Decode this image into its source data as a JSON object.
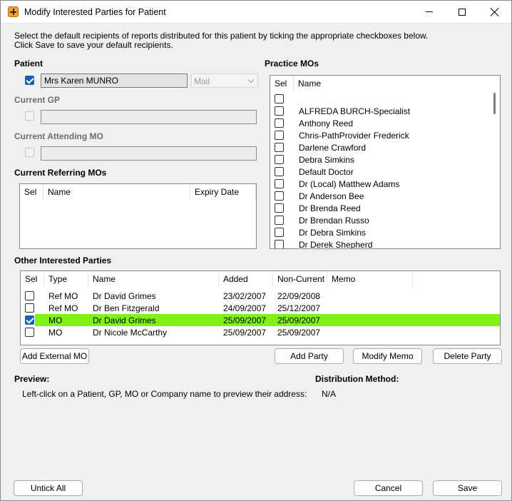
{
  "window": {
    "title": "Modify Interested Parties for Patient"
  },
  "instructions": {
    "line1": "Select the default recipients of reports distributed for this patient by ticking the appropriate checkboxes below.",
    "line2": "Click Save to save your default recipients."
  },
  "patient": {
    "label": "Patient",
    "name": "Mrs Karen MUNRO",
    "checked": true,
    "method_value": "Mail"
  },
  "current_gp": {
    "label": "Current GP",
    "value": ""
  },
  "current_attending_mo": {
    "label": "Current Attending MO",
    "value": ""
  },
  "current_referring_mos": {
    "label": "Current Referring MOs",
    "columns": [
      "Sel",
      "Name",
      "Expiry Date"
    ],
    "rows": []
  },
  "practice_mos": {
    "label": "Practice MOs",
    "columns": [
      "Sel",
      "Name"
    ],
    "rows": [
      "",
      "ALFREDA BURCH-Specialist",
      "Anthony Reed",
      "Chris-PathProvider Frederick",
      "Darlene Crawford",
      "Debra Simkins",
      "Default Doctor",
      "Dr (Local) Matthew Adams",
      "Dr Anderson Bee",
      "Dr Brenda Reed",
      "Dr Brendan Russo",
      "Dr Debra Simkins",
      "Dr Derek Shepherd"
    ]
  },
  "other_parties": {
    "label": "Other Interested Parties",
    "columns": [
      "Sel",
      "Type",
      "Name",
      "Added",
      "Non-Current",
      "Memo"
    ],
    "rows": [
      {
        "checked": false,
        "type": "Ref MO",
        "name": "Dr David Grimes",
        "added": "23/02/2007",
        "noncurrent": "22/09/2008",
        "memo": ""
      },
      {
        "checked": false,
        "type": "Ref MO",
        "name": "Dr Ben Fitzgerald",
        "added": "24/09/2007",
        "noncurrent": "25/12/2007",
        "memo": ""
      },
      {
        "checked": true,
        "type": "MO",
        "name": "Dr David Grimes",
        "added": "25/09/2007",
        "noncurrent": "25/09/2007",
        "memo": "",
        "selected": true
      },
      {
        "checked": false,
        "type": "MO",
        "name": "Dr Nicole McCarthy",
        "added": "25/09/2007",
        "noncurrent": "25/09/2007",
        "memo": ""
      }
    ],
    "highlight_color": "#80f21a"
  },
  "buttons": {
    "add_external_mo": "Add External MO",
    "add_party": "Add Party",
    "modify_memo": "Modify Memo",
    "delete_party": "Delete Party",
    "untick_all": "Untick All",
    "cancel": "Cancel",
    "save": "Save"
  },
  "preview": {
    "label": "Preview:",
    "text": "Left-click on a Patient, GP, MO or Company name to preview their address:"
  },
  "distribution": {
    "label": "Distribution Method:",
    "value": "N/A"
  },
  "icons": {
    "app": "orange-cross-icon",
    "minimize": "minimize-icon",
    "maximize": "maximize-icon",
    "close": "close-icon"
  }
}
